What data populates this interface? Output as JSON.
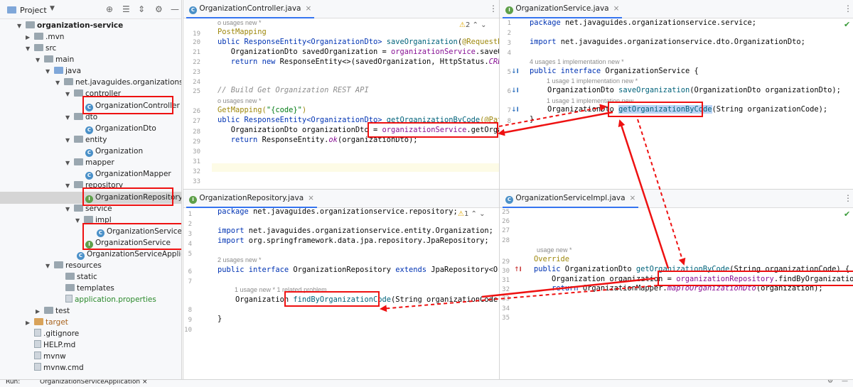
{
  "project_panel": {
    "title": "Project",
    "tree": {
      "root": "organization-service",
      "mvn": ".mvn",
      "src": "src",
      "main": "main",
      "java": "java",
      "pkg": "net.javaguides.organizationservice",
      "controller": "controller",
      "organization_controller": "OrganizationController",
      "dto": "dto",
      "organization_dto": "OrganizationDto",
      "entity": "entity",
      "organization": "Organization",
      "mapper": "mapper",
      "organization_mapper": "OrganizationMapper",
      "repository": "repository",
      "organization_repository": "OrganizationRepository",
      "service": "service",
      "impl": "impl",
      "organization_service_impl": "OrganizationServiceImp",
      "organization_service": "OrganizationService",
      "organization_service_app": "OrganizationServiceApplication",
      "resources": "resources",
      "static": "static",
      "templates": "templates",
      "app_props": "application.properties",
      "test": "test",
      "target": "target",
      "gitignore": ".gitignore",
      "help": "HELP.md",
      "mvnw": "mvnw",
      "mvnw_cmd": "mvnw.cmd"
    }
  },
  "editor_controller": {
    "tab": "OrganizationController.java",
    "warning_count": "2",
    "line_numbers": [
      "19",
      "20",
      "21",
      "22",
      "23",
      "24",
      "25",
      "26",
      "27",
      "28",
      "29",
      "30",
      "31",
      "32",
      "33"
    ],
    "hint1": "o usages   new *",
    "l19": "PostMapping",
    "l20a": "ublic ResponseEntity<OrganizationDto> ",
    "l20b": "saveOrganization",
    "l20c": "(",
    "l20d": "@RequestBody",
    "l21a": "   OrganizationDto savedOrganization = ",
    "l21b": "organizationService",
    "l21c": ".saveOrgan",
    "l22a": "   ",
    "l22b": "return new",
    "l22c": " ResponseEntity<>(savedOrganization, HttpStatus.",
    "l22d": "CREATED",
    "l25": "// Build Get Organization REST API",
    "hint2": "o usages   new *",
    "l26a": "GetMapping(",
    "l26b": "\"{code}\"",
    "l26c": ")",
    "l27a": "ublic ResponseEntity<OrganizationDto> ",
    "l27b": "getOrganizationByCode",
    "l27c": "(@PathVar",
    "l28a": "   OrganizationDto organizationDto = ",
    "l28b": "organizationService",
    "l28c": ".getOrganiza",
    "l29a": "   ",
    "l29b": "return",
    "l29c": " ResponseEntity.",
    "l29d": "ok",
    "l29e": "(organizationDto);"
  },
  "editor_service": {
    "tab": "OrganizationService.java",
    "line_numbers": [
      "1",
      "2",
      "3",
      "4",
      "5",
      "6",
      "7",
      "8"
    ],
    "l1a": "package",
    "l1b": " net.javaguides.organizationservice.service;",
    "l3a": "import",
    "l3b": " net.javaguides.organizationservice.dto.OrganizationDto;",
    "hint1": "4 usages   1 implementation   new *",
    "l5a": "public interface",
    "l5b": " OrganizationService {",
    "hint2": "1 usage   1 implementation   new *",
    "l6a": "    OrganizationDto ",
    "l6b": "saveOrganization",
    "l6c": "(OrganizationDto organizationDto);",
    "hint3": "1 usage   1 implementation   new",
    "l7a": "    OrganizationDto ",
    "l7b": "getOrganizationByCode",
    "l7c": "(String organizationCode);",
    "l8": "}"
  },
  "editor_repository": {
    "tab": "OrganizationRepository.java",
    "warning_count": "1",
    "line_numbers": [
      "1",
      "2",
      "3",
      "4",
      "5",
      "6",
      "7",
      "8",
      "9",
      "10"
    ],
    "l1a": "package",
    "l1b": " net.javaguides.organizationservice.repository;",
    "l3a": "import",
    "l3b": " net.javaguides.organizationservice.entity.Organization;",
    "l4a": "import",
    "l4b": " org.springframework.data.jpa.repository.JpaRepository;",
    "hint1": "2 usages   new *",
    "l6a": "public interface",
    "l6b": " OrganizationRepository ",
    "l6c": "extends",
    "l6d": " JpaRepository<Organi",
    "hint2": "1 usage   new *   1 related problem",
    "l8a": "    Organization ",
    "l8b": "findByOrganizationCode",
    "l8c": "(String organizationCode);",
    "l10": "}"
  },
  "editor_impl": {
    "tab": "OrganizationServiceImpl.java",
    "line_numbers": [
      "25",
      "26",
      "27",
      "28",
      "29",
      "30",
      "31",
      "32",
      "33",
      "34",
      "35"
    ],
    "hint1": "usage   new *",
    "l30": "Override",
    "l31a": "public",
    "l31b": " OrganizationDto ",
    "l31c": "getOrganizationByCode",
    "l31d": "(String organizationCode) {",
    "l32a": "    Organization organization = ",
    "l32b": "organizationRepository",
    "l32c": ".findByOrganizationCode(o",
    "l33a": "    ",
    "l33b": "return",
    "l33c": " OrganizationMapper.",
    "l33d": "mapToOrganizationDto",
    "l33e": "(organization);"
  },
  "run_bar": {
    "label": "Run:",
    "tab": "OrganizationServiceApplication"
  },
  "colors": {
    "annotation_red": "#ee1111",
    "selection": "#bcd4f6",
    "keyword": "#0033b3"
  }
}
